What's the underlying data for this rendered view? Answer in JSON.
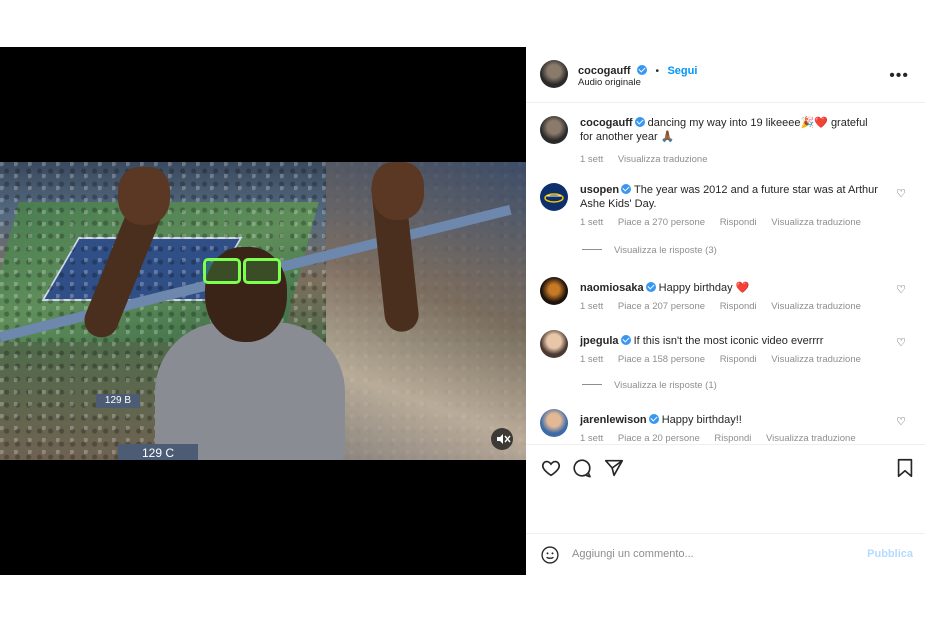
{
  "post": {
    "author": "cocogauff",
    "follow_label": "Segui",
    "separator": "•",
    "audio": "Audio originale",
    "more_menu": "•••"
  },
  "media": {
    "sign_main": "129 C",
    "sign_small": "129 B",
    "mute_icon": "muted-speaker-icon"
  },
  "caption": {
    "author": "cocogauff",
    "text": "dancing my way into 19 likeeee🎉❤️ grateful for another year 🙏🏾",
    "time": "1 sett",
    "translate": "Visualizza traduzione"
  },
  "comments": [
    {
      "user": "usopen",
      "text": "The year was 2012 and a future star was at Arthur Ashe Kids' Day.",
      "time": "1 sett",
      "likes": "Piace a 270 persone",
      "reply": "Rispondi",
      "translate": "Visualizza traduzione",
      "replies": "Visualizza le risposte (3)"
    },
    {
      "user": "naomiosaka",
      "text": "Happy birthday ❤️",
      "time": "1 sett",
      "likes": "Piace a 207 persone",
      "reply": "Rispondi",
      "translate": "Visualizza traduzione"
    },
    {
      "user": "jpegula",
      "text": "If this isn't the most iconic video everrrr",
      "time": "1 sett",
      "likes": "Piace a 158 persone",
      "reply": "Rispondi",
      "translate": "Visualizza traduzione",
      "replies": "Visualizza le risposte (1)"
    },
    {
      "user": "jarenlewison",
      "text": "Happy birthday!!",
      "time": "1 sett",
      "likes": "Piace a 20 persone",
      "reply": "Rispondi",
      "translate": "Visualizza traduzione"
    }
  ],
  "composer": {
    "placeholder": "Aggiungi un commento...",
    "publish": "Pubblica"
  },
  "colors": {
    "link": "#0095f6",
    "muted": "#8e8e8e",
    "verified": "#3897f0"
  }
}
